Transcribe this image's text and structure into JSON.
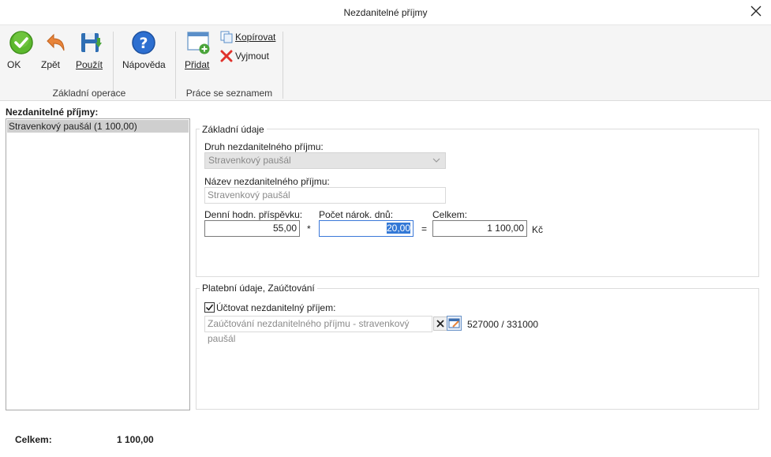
{
  "window": {
    "title": "Nezdanitelné příjmy"
  },
  "ribbon": {
    "ok": "OK",
    "back": "Zpět",
    "apply": "Použít",
    "help": "Nápověda",
    "add": "Přidat",
    "copy": "Kopírovat",
    "cut": "Vyjmout",
    "group_basic": "Základní operace",
    "group_list": "Práce se seznamem"
  },
  "list": {
    "title": "Nezdanitelné příjmy:",
    "items": [
      "Stravenkový paušál (1 100,00)"
    ]
  },
  "basic": {
    "title": "Základní údaje",
    "type_label": "Druh nezdanitelného příjmu:",
    "type_value": "Stravenkový paušál",
    "name_label": "Název nezdanitelného příjmu:",
    "name_value": "Stravenkový paušál",
    "daily_label": "Denní hodn. příspěvku:",
    "daily_value": "55,00",
    "mult": "*",
    "days_label": "Počet nárok. dnů:",
    "days_value": "20,00",
    "eq": "=",
    "total_label": "Celkem:",
    "total_value": "1 100,00",
    "currency": "Kč"
  },
  "payment": {
    "title": "Platební údaje, Zaúčtování",
    "check_label": "Účtovat nezdanitelný příjem:",
    "checked": true,
    "posting_value": "Zaúčtování nezdanitelného příjmu - stravenkový paušál",
    "accounts": "527000 / 331000"
  },
  "footer": {
    "label": "Celkem:",
    "value": "1 100,00"
  },
  "colors": {
    "accent": "#3378d6",
    "ok_green": "#5cb82e",
    "back_orange": "#e8843a",
    "help_blue": "#2d6fd0"
  }
}
